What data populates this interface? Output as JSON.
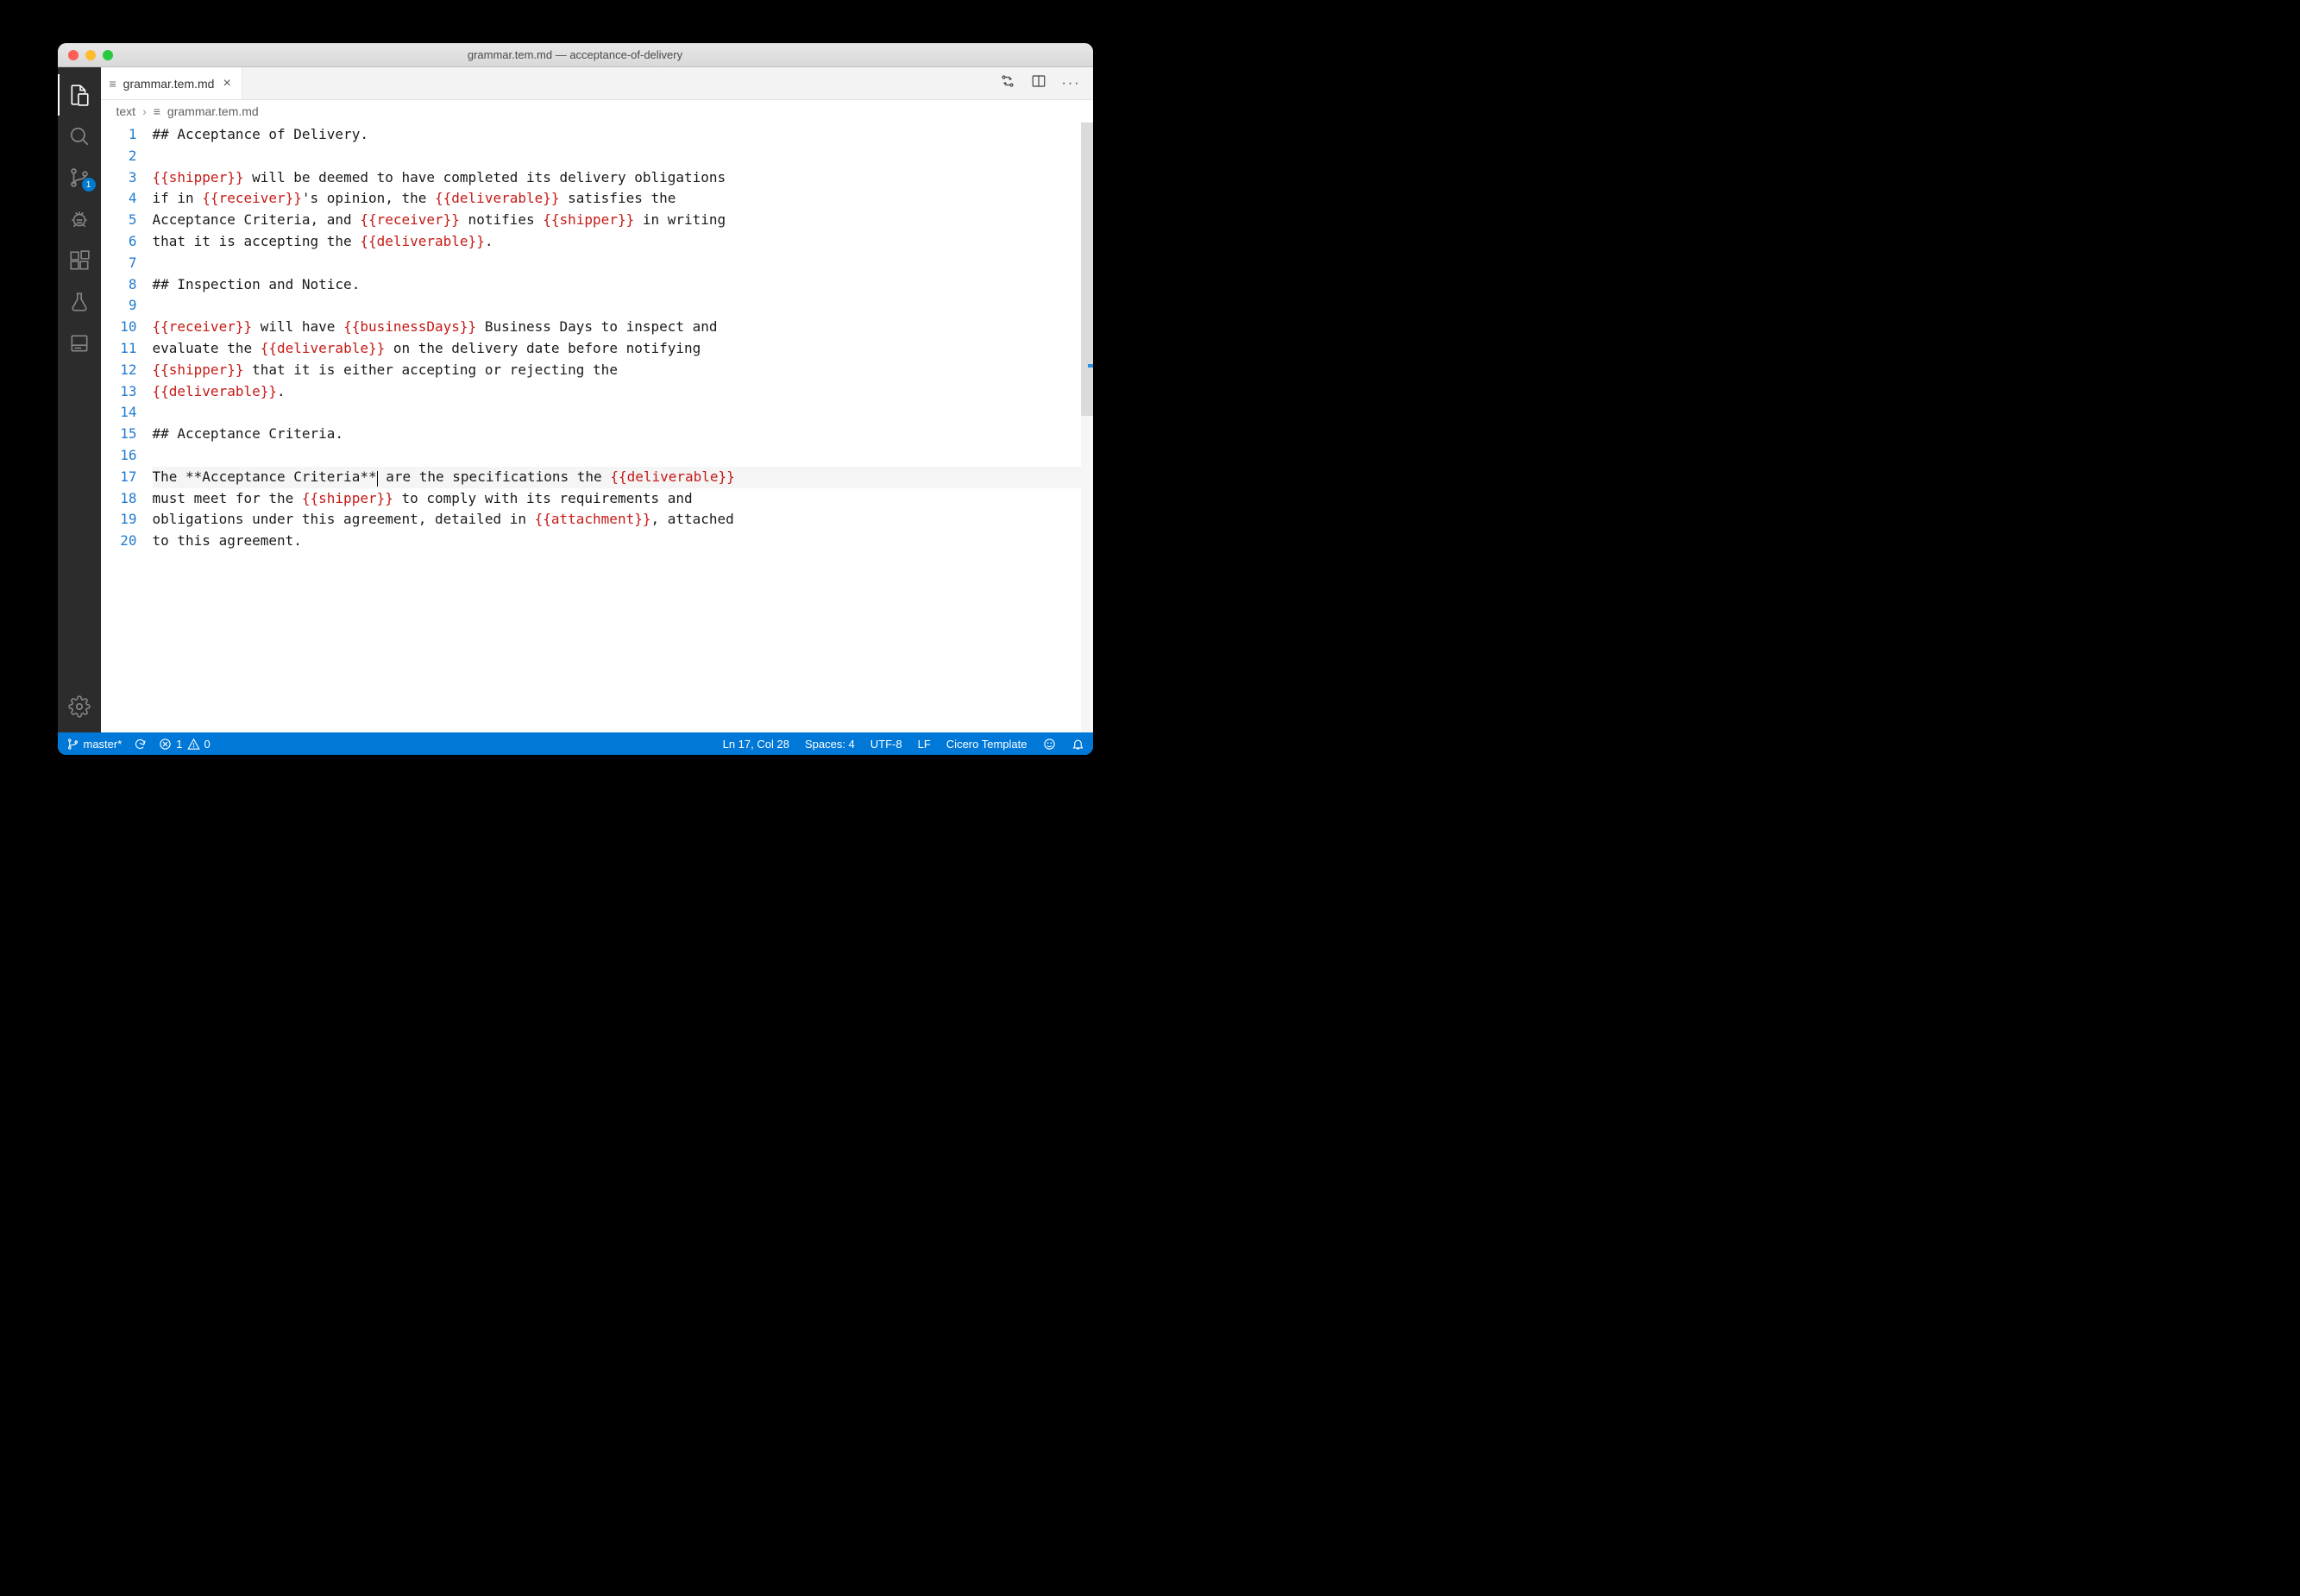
{
  "window": {
    "title": "grammar.tem.md — acceptance-of-delivery"
  },
  "activitybar": {
    "scm_badge": "1"
  },
  "tab": {
    "filename": "grammar.tem.md"
  },
  "breadcrumb": {
    "folder": "text",
    "file": "grammar.tem.md"
  },
  "editor": {
    "current_line": 17,
    "lines": [
      {
        "n": 1,
        "segs": [
          {
            "t": "## Acceptance of Delivery.",
            "c": "t-md"
          }
        ]
      },
      {
        "n": 2,
        "segs": []
      },
      {
        "n": 3,
        "segs": [
          {
            "t": "{{shipper}}",
            "c": "t-var"
          },
          {
            "t": " will be deemed to have completed its delivery obligations"
          }
        ]
      },
      {
        "n": 4,
        "segs": [
          {
            "t": "if in "
          },
          {
            "t": "{{receiver}}",
            "c": "t-var"
          },
          {
            "t": "'s opinion, the "
          },
          {
            "t": "{{deliverable}}",
            "c": "t-var"
          },
          {
            "t": " satisfies the"
          }
        ]
      },
      {
        "n": 5,
        "segs": [
          {
            "t": "Acceptance Criteria, and "
          },
          {
            "t": "{{receiver}}",
            "c": "t-var"
          },
          {
            "t": " notifies "
          },
          {
            "t": "{{shipper}}",
            "c": "t-var"
          },
          {
            "t": " in writing"
          }
        ]
      },
      {
        "n": 6,
        "segs": [
          {
            "t": "that it is accepting the "
          },
          {
            "t": "{{deliverable}}",
            "c": "t-var"
          },
          {
            "t": "."
          }
        ]
      },
      {
        "n": 7,
        "segs": []
      },
      {
        "n": 8,
        "segs": [
          {
            "t": "## Inspection and Notice.",
            "c": "t-md"
          }
        ]
      },
      {
        "n": 9,
        "segs": []
      },
      {
        "n": 10,
        "segs": [
          {
            "t": "{{receiver}}",
            "c": "t-var"
          },
          {
            "t": " will have "
          },
          {
            "t": "{{businessDays}}",
            "c": "t-var"
          },
          {
            "t": " Business Days to inspect and"
          }
        ]
      },
      {
        "n": 11,
        "segs": [
          {
            "t": "evaluate the "
          },
          {
            "t": "{{deliverable}}",
            "c": "t-var"
          },
          {
            "t": " on the delivery date before notifying"
          }
        ]
      },
      {
        "n": 12,
        "segs": [
          {
            "t": "{{shipper}}",
            "c": "t-var"
          },
          {
            "t": " that it is either accepting or rejecting the"
          }
        ]
      },
      {
        "n": 13,
        "segs": [
          {
            "t": "{{deliverable}}",
            "c": "t-var"
          },
          {
            "t": "."
          }
        ]
      },
      {
        "n": 14,
        "segs": []
      },
      {
        "n": 15,
        "segs": [
          {
            "t": "## Acceptance Criteria.",
            "c": "t-md"
          }
        ]
      },
      {
        "n": 16,
        "segs": []
      },
      {
        "n": 17,
        "segs": [
          {
            "t": "The **Acceptance Criteria**"
          },
          {
            "t": "",
            "cursor": true
          },
          {
            "t": " are the specifications the "
          },
          {
            "t": "{{deliverable}}",
            "c": "t-var"
          }
        ]
      },
      {
        "n": 18,
        "segs": [
          {
            "t": "must meet for the "
          },
          {
            "t": "{{shipper}}",
            "c": "t-var"
          },
          {
            "t": " to comply with its requirements and"
          }
        ]
      },
      {
        "n": 19,
        "segs": [
          {
            "t": "obligations under this agreement, detailed in "
          },
          {
            "t": "{{attachment}}",
            "c": "t-var"
          },
          {
            "t": ", attached"
          }
        ]
      },
      {
        "n": 20,
        "segs": [
          {
            "t": "to this agreement."
          }
        ]
      }
    ]
  },
  "status": {
    "branch": "master*",
    "errors": "1",
    "warnings": "0",
    "cursor": "Ln 17, Col 28",
    "indent": "Spaces: 4",
    "encoding": "UTF-8",
    "eol": "LF",
    "language": "Cicero Template"
  }
}
